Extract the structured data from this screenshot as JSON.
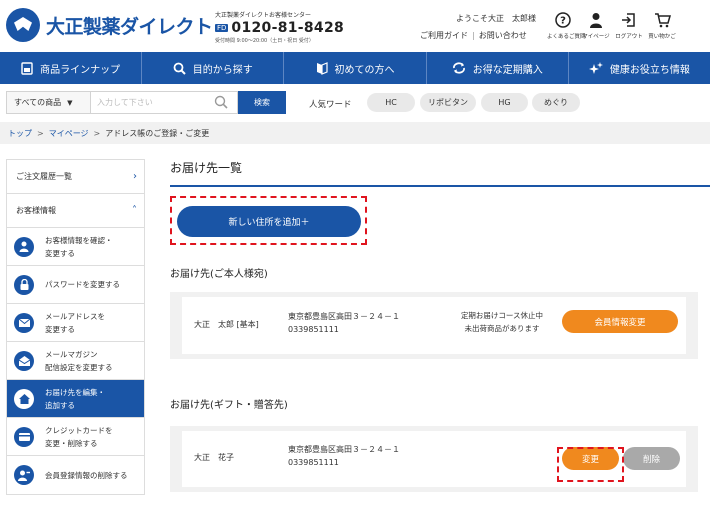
{
  "brand": {
    "logo_text": "大正製薬ダイレクト",
    "tel_caption": "大正製薬ダイレクトお客様センター",
    "tel_badge": "FD",
    "tel_number": "0120-81-8428",
    "tel_hours": "受付時間 9:00〜20:00（土日・祝日 受付）"
  },
  "header": {
    "welcome": "ようこそ大正　太郎様",
    "guide_link": "ご利用ガイド",
    "contact_link": "お問い合わせ",
    "utilities": [
      {
        "label": "よくあるご質問",
        "icon": "question-icon"
      },
      {
        "label": "マイページ",
        "icon": "person-icon"
      },
      {
        "label": "ログアウト",
        "icon": "logout-icon"
      },
      {
        "label": "買い物かご",
        "icon": "cart-icon"
      }
    ]
  },
  "nav": {
    "items": [
      {
        "label": "商品ラインナップ",
        "icon": "product-icon"
      },
      {
        "label": "目的から探す",
        "icon": "search-icon"
      },
      {
        "label": "初めての方へ",
        "icon": "beginner-icon"
      },
      {
        "label": "お得な定期購入",
        "icon": "refresh-icon"
      },
      {
        "label": "健康お役立ち情報",
        "icon": "sparkle-icon"
      }
    ]
  },
  "search": {
    "category": "すべての商品",
    "placeholder": "入力して下さい",
    "button": "検索",
    "popular_label": "人気ワード",
    "tags": [
      "HC",
      "リポビタン",
      "HG",
      "めぐり"
    ]
  },
  "breadcrumb": {
    "items": [
      "トップ",
      "マイページ",
      "アドレス帳のご登録・ご変更"
    ]
  },
  "sidebar": {
    "order_history": "ご注文履歴一覧",
    "customer_info": "お客様情報",
    "items": [
      {
        "label": "お客様情報を確認・\n変更する",
        "icon": "user-icon"
      },
      {
        "label": "パスワードを変更する",
        "icon": "lock-icon"
      },
      {
        "label": "メールアドレスを\n変更する",
        "icon": "mail-icon"
      },
      {
        "label": "メールマガジン\n配信設定を変更する",
        "icon": "newsletter-icon"
      },
      {
        "label": "お届け先を編集・\n追加する",
        "icon": "home-icon"
      },
      {
        "label": "クレジットカードを\n変更・削除する",
        "icon": "card-icon"
      },
      {
        "label": "会員登録情報の削除する",
        "icon": "user-remove-icon"
      }
    ]
  },
  "main": {
    "title": "お届け先一覧",
    "add_button": "新しい住所を追加＋",
    "self_section": "お届け先(ご本人様宛)",
    "self_card": {
      "name": "大正　太郎 [基本]",
      "address": "東京都豊島区高田３－２４－１",
      "phone": "0339851111",
      "notice_1": "定期お届けコース休止中",
      "notice_2": "未出荷商品があります",
      "button": "会員情報変更"
    },
    "gift_section": "お届け先(ギフト・贈答先)",
    "gift_card": {
      "name": "大正　花子",
      "address": "東京都豊島区高田３－２４－１",
      "phone": "0339851111",
      "edit_button": "変更",
      "delete_button": "削除"
    }
  },
  "colors": {
    "primary": "#1a55a6",
    "orange": "#f0891e",
    "highlight": "#e0141e"
  }
}
